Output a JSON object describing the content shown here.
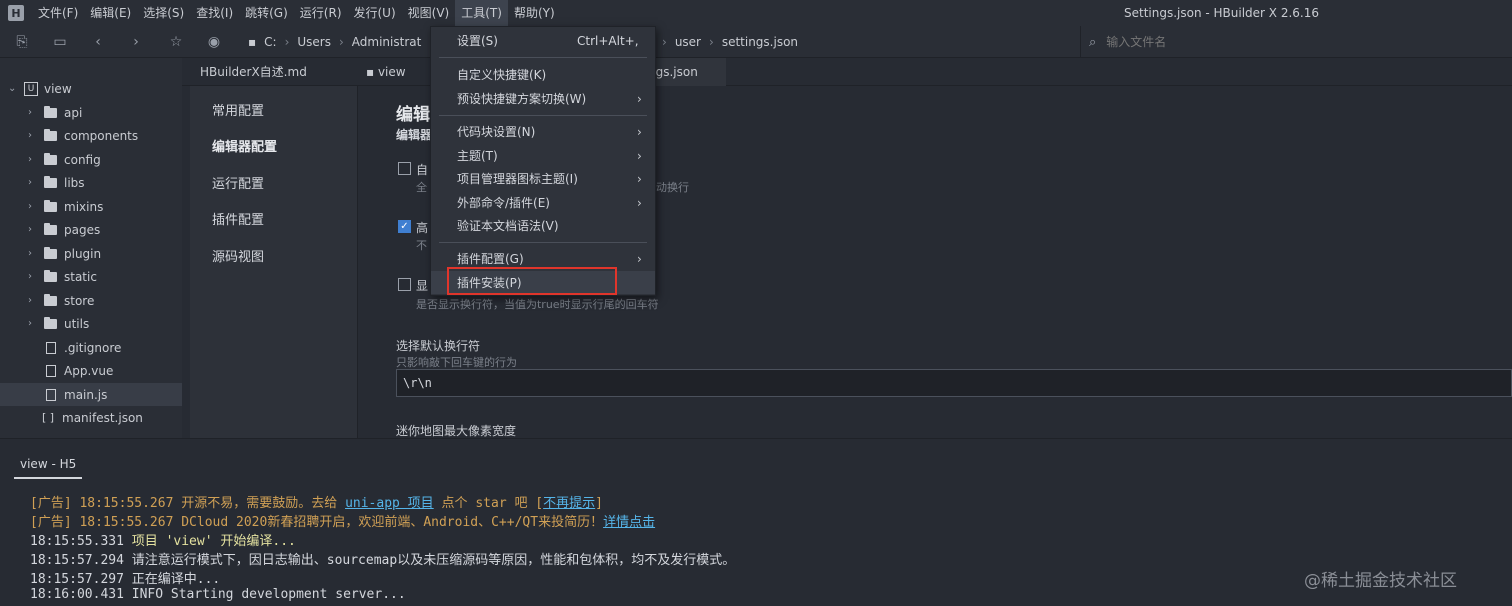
{
  "menubar": {
    "logo": "H",
    "items": [
      "文件(F)",
      "编辑(E)",
      "选择(S)",
      "查找(I)",
      "跳转(G)",
      "运行(R)",
      "发行(U)",
      "视图(V)",
      "工具(T)",
      "帮助(Y)"
    ],
    "active_index": 8
  },
  "window_title": "Settings.json - HBuilder X 2.6.16",
  "toolbar": {
    "crumbs_left": [
      "C:",
      "Users",
      "Administrat"
    ],
    "crumbs_right": [
      "user",
      "settings.json"
    ],
    "search_placeholder": "输入文件名"
  },
  "sidebar": {
    "root": "view",
    "folders": [
      "api",
      "components",
      "config",
      "libs",
      "mixins",
      "pages",
      "plugin",
      "static",
      "store",
      "utils"
    ],
    "files": [
      ".gitignore",
      "App.vue",
      "main.js"
    ],
    "json_files": [
      "manifest.json"
    ]
  },
  "tabs": [
    "HBuilderX自述.md",
    "view",
    "ngs.json"
  ],
  "settings_nav": [
    "常用配置",
    "编辑器配置",
    "运行配置",
    "插件配置",
    "源码视图"
  ],
  "settings": {
    "title": "编辑",
    "subtitle": "编辑器",
    "options": [
      {
        "label": "自",
        "desc_left": "全",
        "desc_right": "动换行",
        "checked": false
      },
      {
        "label": "高",
        "desc_left": "不",
        "desc_right": "",
        "checked": true
      },
      {
        "label": "显",
        "desc_left": "是否显示换行符，当值为true时显示行尾的回车符",
        "desc_right": "",
        "checked": false
      }
    ],
    "newline_label": "选择默认换行符",
    "newline_desc": "只影响敲下回车键的行为",
    "newline_value": "\\r\\n",
    "minimap_label": "迷你地图最大像素宽度"
  },
  "dropdown": {
    "settings": "设置(S)",
    "settings_shortcut": "Ctrl+Alt+,",
    "custom_keys": "自定义快捷键(K)",
    "preset_keys": "预设快捷键方案切换(W)",
    "snippets": "代码块设置(N)",
    "theme": "主题(T)",
    "icon_theme": "项目管理器图标主题(I)",
    "external": "外部命令/插件(E)",
    "validate": "验证本文档语法(V)",
    "plugin_config": "插件配置(G)",
    "plugin_install": "插件安装(P)",
    "arrow": "›"
  },
  "console": {
    "tab": "view - H5",
    "line1": {
      "prefix": "[广告] 18:15:55.267 开源不易，需要鼓励。去给 ",
      "link": "uni-app 项目",
      "mid": " 点个 star 吧 [",
      "link2": "不再提示",
      "suffix": "]"
    },
    "line2": {
      "prefix": "[广告] 18:15:55.267 DCloud 2020新春招聘开启，欢迎前端、Android、C++/QT来投简历！",
      "link": "详情点击"
    },
    "line3": {
      "time": "18:15:55.331",
      "text": " 项目 'view' 开始编译..."
    },
    "line4": {
      "time": "18:15:57.294",
      "text": " 请注意运行模式下，因日志输出、sourcemap以及未压缩源码等原因，性能和包体积，均不及发行模式。"
    },
    "line5": {
      "time": "18:15:57.297",
      "text": " 正在编译中..."
    },
    "line6": {
      "time": "18:16:00.431",
      "text": "  INFO  Starting development server..."
    }
  },
  "watermark": "@稀土掘金技术社区"
}
